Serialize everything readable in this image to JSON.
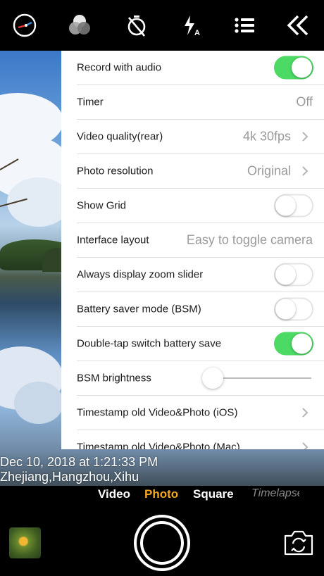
{
  "toolbar": {
    "icons": [
      "exposure-dial-icon",
      "color-filter-icon",
      "timer-off-icon",
      "flash-auto-icon",
      "settings-list-icon",
      "collapse-chevrons-icon"
    ]
  },
  "settings": {
    "rows": [
      {
        "label": "Record with audio",
        "control": "toggle",
        "on": true
      },
      {
        "label": "Timer",
        "value": "Off"
      },
      {
        "label": "Video quality(rear)",
        "value": "4k 30fps",
        "chevron": true
      },
      {
        "label": "Photo resolution",
        "value": "Original",
        "chevron": true
      },
      {
        "label": "Show Grid",
        "control": "toggle",
        "on": false
      },
      {
        "label": "Interface layout",
        "value": "Easy to toggle camera"
      },
      {
        "label": "Always display zoom slider",
        "control": "toggle",
        "on": false
      },
      {
        "label": "Battery saver mode (BSM)",
        "control": "toggle",
        "on": false
      },
      {
        "label": "Double-tap switch battery save",
        "control": "toggle",
        "on": true
      },
      {
        "label": "BSM brightness",
        "control": "slider",
        "level": 0.0
      },
      {
        "label": "Timestamp old Video&Photo (iOS)",
        "chevron": true
      },
      {
        "label": "Timestamp old Video&Photo (Mac)",
        "chevron": true
      }
    ]
  },
  "overlay": {
    "timestamp": "Dec 10, 2018 at 1:21:33 PM",
    "location": "Zhejiang,Hangzhou,Xihu"
  },
  "modes": {
    "items": [
      {
        "label": "Video",
        "active": false
      },
      {
        "label": "Photo",
        "active": true
      },
      {
        "label": "Square",
        "active": false
      },
      {
        "label": "Timelapse",
        "active": false
      }
    ]
  },
  "colors": {
    "accent": "#f5a623",
    "toggle_on": "#4cd964"
  }
}
